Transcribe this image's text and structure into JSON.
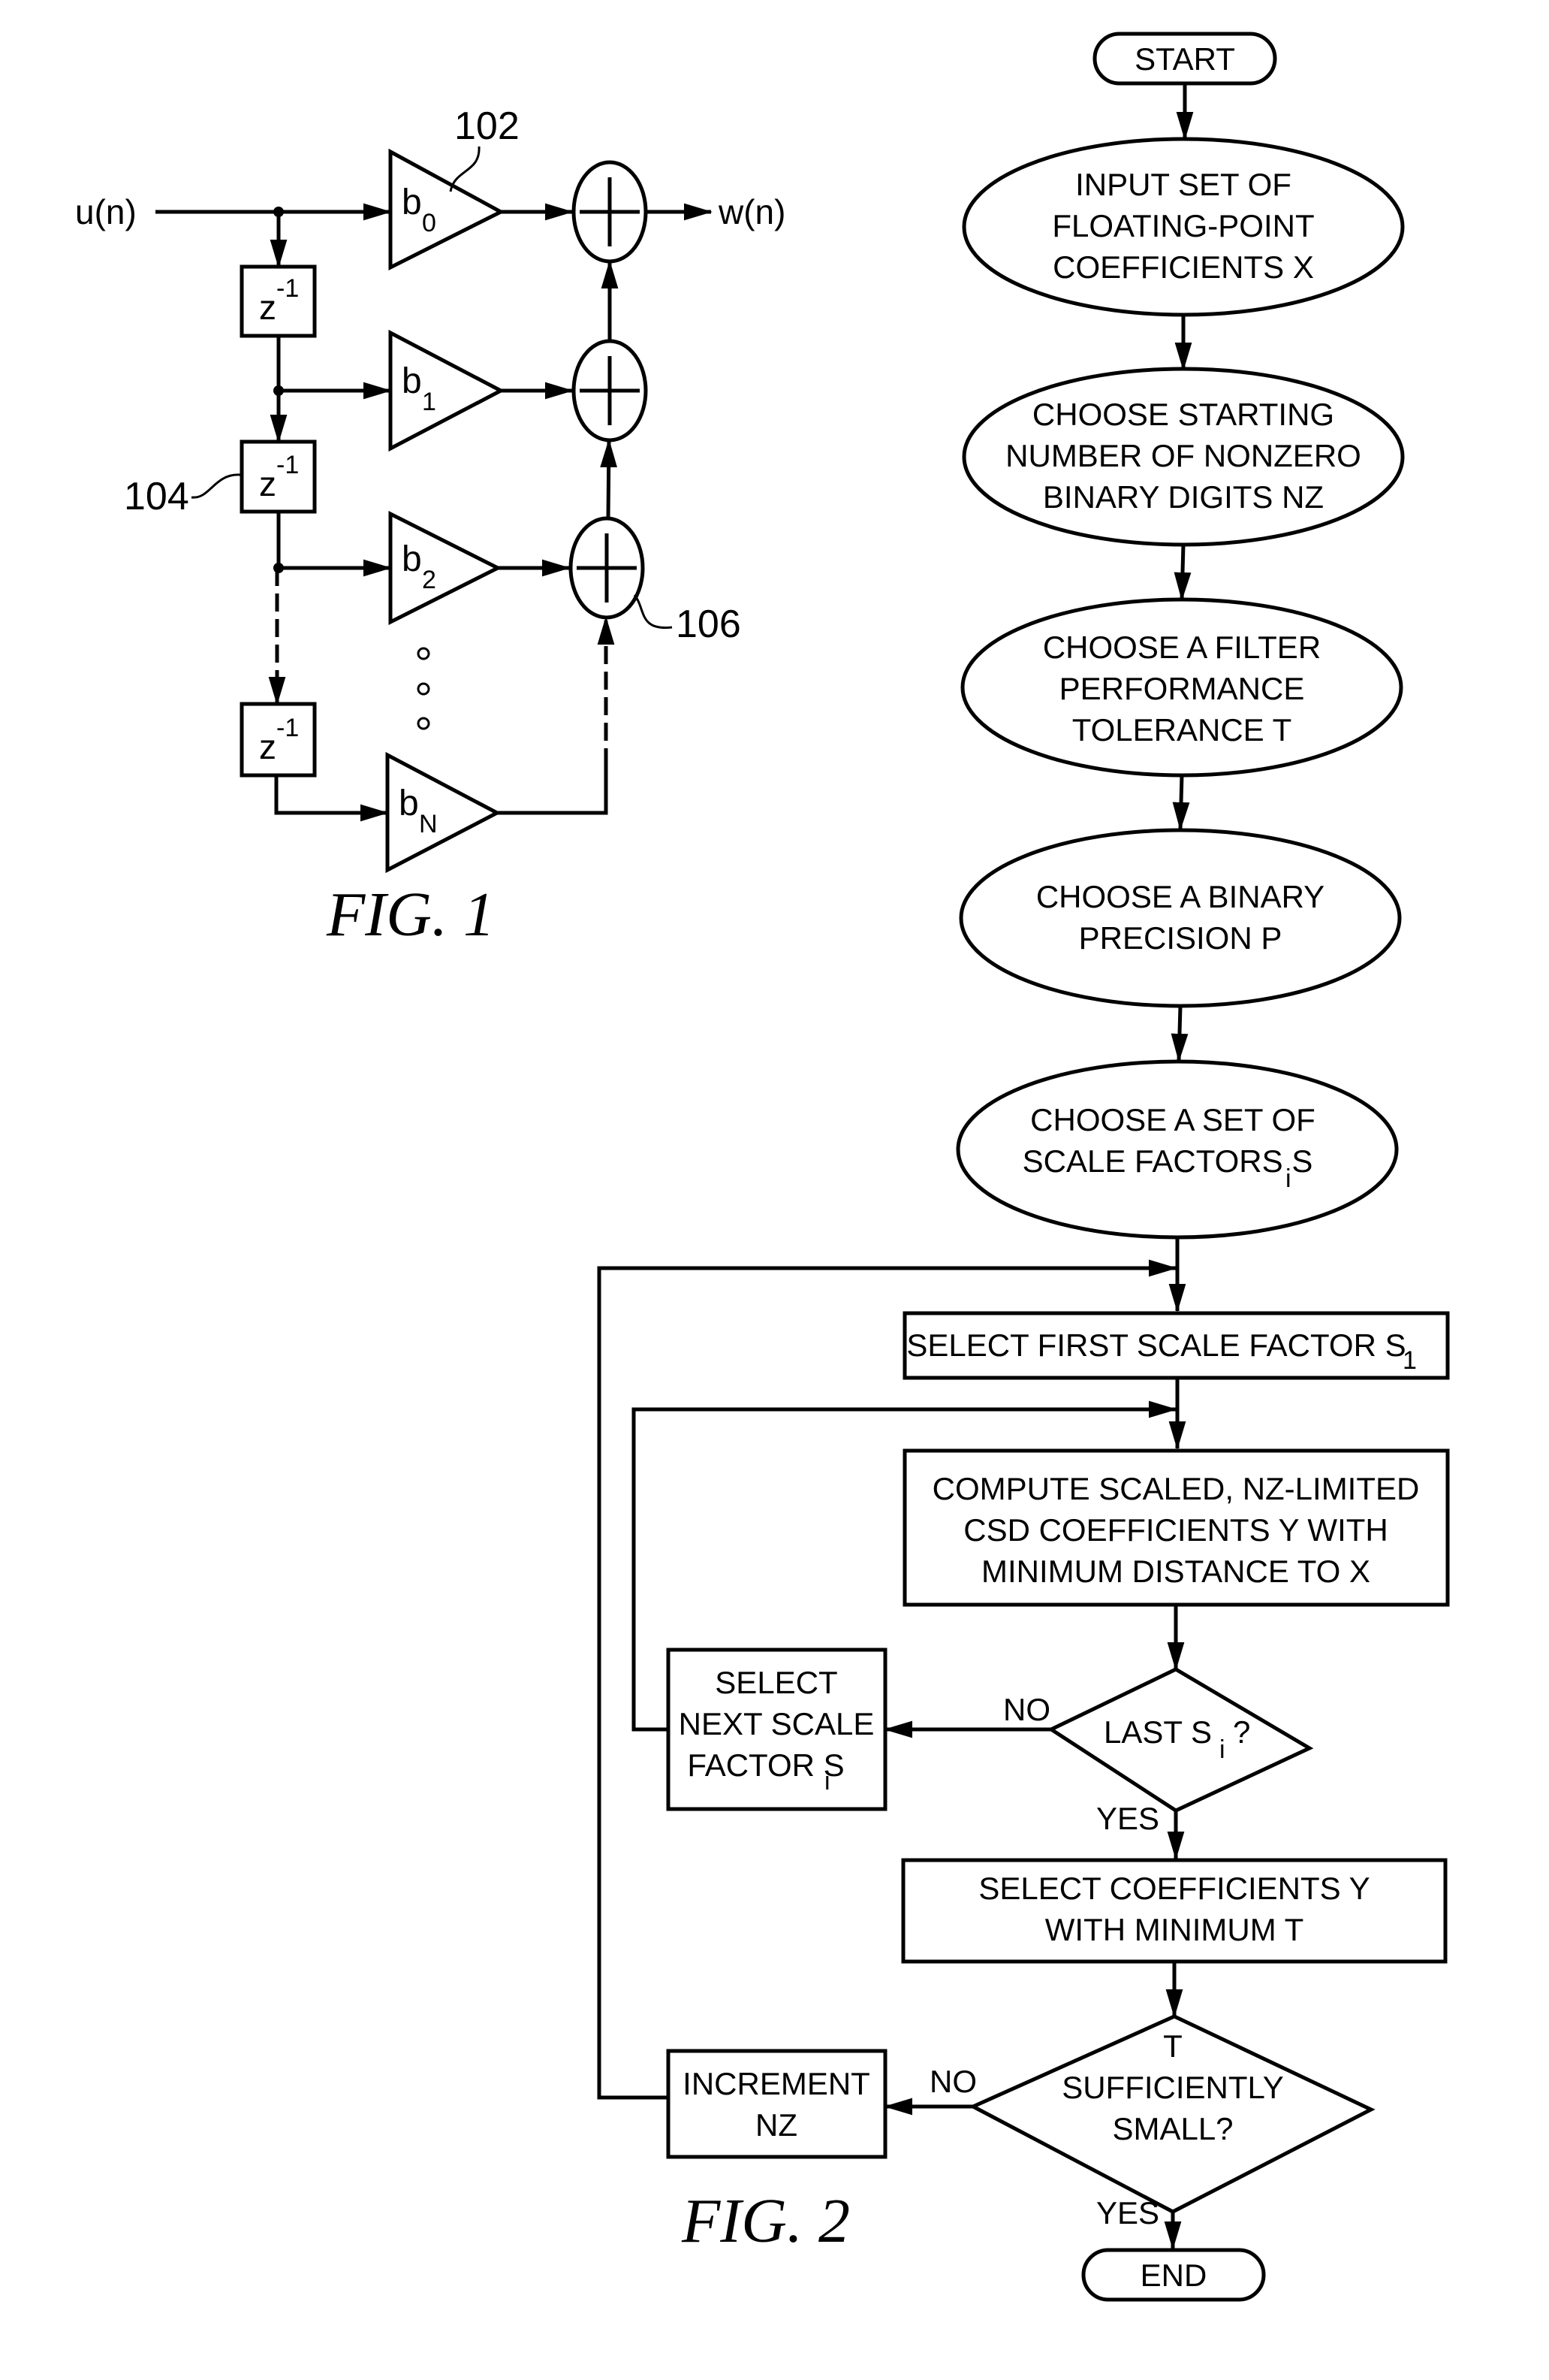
{
  "fig1": {
    "caption": "FIG. 1",
    "input_label": "u(n)",
    "output_label": "w(n)",
    "ref_gain": "102",
    "ref_delay": "104",
    "ref_adder": "106",
    "delay_label": "z",
    "delay_exp": "-1",
    "gains": [
      {
        "base": "b",
        "sub": "0"
      },
      {
        "base": "b",
        "sub": "1"
      },
      {
        "base": "b",
        "sub": "2"
      },
      {
        "base": "b",
        "sub": "N"
      }
    ]
  },
  "fig2": {
    "caption": "FIG. 2",
    "start": "START",
    "end": "END",
    "steps": {
      "input": [
        "INPUT SET OF",
        "FLOATING-POINT",
        "COEFFICIENTS X"
      ],
      "nz": [
        "CHOOSE STARTING",
        "NUMBER OF NONZERO",
        "BINARY DIGITS NZ"
      ],
      "tolerance": [
        "CHOOSE A FILTER",
        "PERFORMANCE",
        "TOLERANCE T"
      ],
      "precision": [
        "CHOOSE A BINARY",
        "PRECISION P"
      ],
      "scale_set": [
        "CHOOSE A SET OF",
        "SCALE FACTORS S",
        "i"
      ],
      "first_scale": [
        "SELECT FIRST SCALE FACTOR S",
        "1"
      ],
      "compute": [
        "COMPUTE SCALED, NZ-LIMITED",
        "CSD COEFFICIENTS Y WITH",
        "MINIMUM DISTANCE TO X"
      ],
      "next_scale": [
        "SELECT",
        "NEXT SCALE",
        "FACTOR S",
        "i"
      ],
      "select_coeff": [
        "SELECT COEFFICIENTS Y",
        "WITH MINIMUM T"
      ],
      "increment": [
        "INCREMENT",
        "NZ"
      ]
    },
    "decisions": {
      "last_si": {
        "text": "LAST S",
        "sub": "i",
        "suffix": "?"
      },
      "t_small": [
        "T",
        "SUFFICIENTLY",
        "SMALL?"
      ]
    },
    "branch_labels": {
      "no": "NO",
      "yes": "YES"
    }
  }
}
